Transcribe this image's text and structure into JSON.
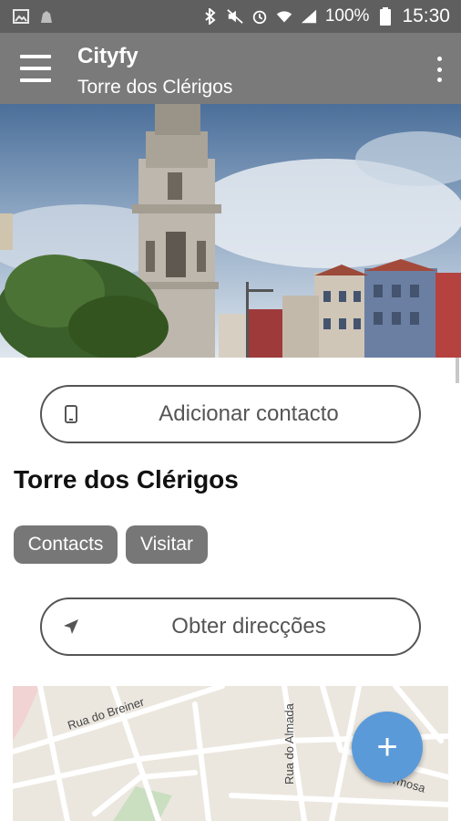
{
  "status_bar": {
    "battery": "100%",
    "time": "15:30"
  },
  "app_bar": {
    "title": "Cityfy",
    "subtitle": "Torre dos Clérigos"
  },
  "actions": {
    "add_contact": "Adicionar contacto",
    "directions": "Obter direcções"
  },
  "place": {
    "name": "Torre dos Clérigos",
    "tags": [
      "Contacts",
      "Visitar"
    ]
  },
  "map": {
    "street_labels": [
      "Rua do Breiner",
      "Rua do Almada",
      "R. Formosa"
    ]
  },
  "fab": {
    "icon": "plus-icon",
    "label": "+"
  },
  "colors": {
    "status_bar": "#5f5f5f",
    "app_bar": "#7a7a7a",
    "chip": "#777777",
    "fab": "#5b9ad9"
  }
}
